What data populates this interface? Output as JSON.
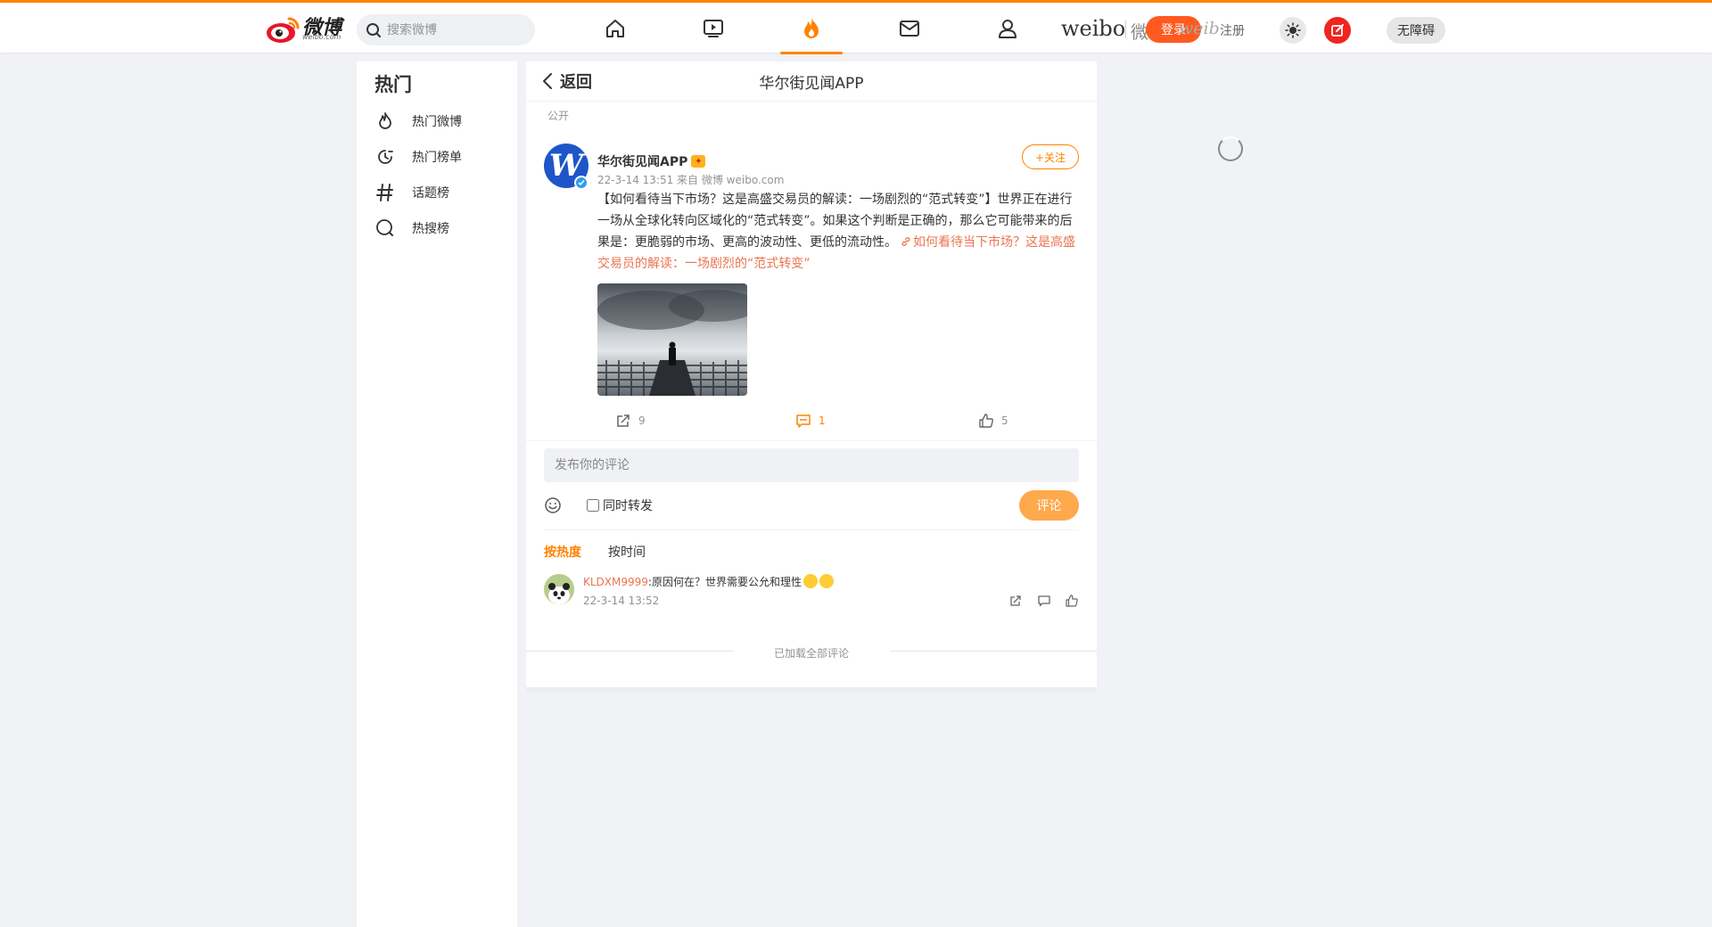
{
  "header": {
    "logo_cn": "微博",
    "logo_en": "weibo.com",
    "search_placeholder": "搜索微博",
    "brand_text": "weibo",
    "brand_cn": "微博",
    "login_label": "登录",
    "brand_ghost": "weib",
    "register_label": "注册",
    "accessibility_label": "无障碍",
    "nav": [
      {
        "name": "home",
        "icon": "home-icon"
      },
      {
        "name": "video",
        "icon": "video-icon"
      },
      {
        "name": "hot",
        "icon": "fire-icon",
        "active": true
      },
      {
        "name": "messages",
        "icon": "mail-icon"
      },
      {
        "name": "profile",
        "icon": "user-icon"
      }
    ],
    "accent_color": "#ff8200"
  },
  "sidebar": {
    "title": "热门",
    "items": [
      {
        "label": "热门微博",
        "icon": "flame-outline-icon"
      },
      {
        "label": "热门榜单",
        "icon": "clock-rank-icon"
      },
      {
        "label": "话题榜",
        "icon": "hashtag-icon"
      },
      {
        "label": "热搜榜",
        "icon": "search-circle-icon"
      }
    ]
  },
  "main": {
    "back_label": "返回",
    "page_title": "华尔街见闻APP",
    "visibility": "公开",
    "post": {
      "author": "华尔街见闻APP",
      "avatar_letter": "W",
      "meta": "22-3-14 13:51  来自 微博 weibo.com",
      "follow_label": "+关注",
      "text": "【如何看待当下市场？这是高盛交易员的解读：一场剧烈的“范式转变”】世界正在进行一场从全球化转向区域化的“范式转变”。如果这个判断是正确的，那么它可能带来的后果是：更脆弱的市场、更高的波动性、更低的流动性。",
      "link_text": "如何看待当下市场？这是高盛交易员的解读：一场剧烈的“范式转变”",
      "reposts": "9",
      "comments": "1",
      "likes": "5"
    },
    "comment_box": {
      "placeholder": "发布你的评论",
      "repost_label": "同时转发",
      "submit_label": "评论"
    },
    "sort_tabs": {
      "hot": "按热度",
      "time": "按时间"
    },
    "comments": [
      {
        "user": "KLDXM9999",
        "text": ":原因何在？世界需要公允和理性",
        "time": "22-3-14 13:52"
      }
    ],
    "end_note": "已加载全部评论"
  }
}
